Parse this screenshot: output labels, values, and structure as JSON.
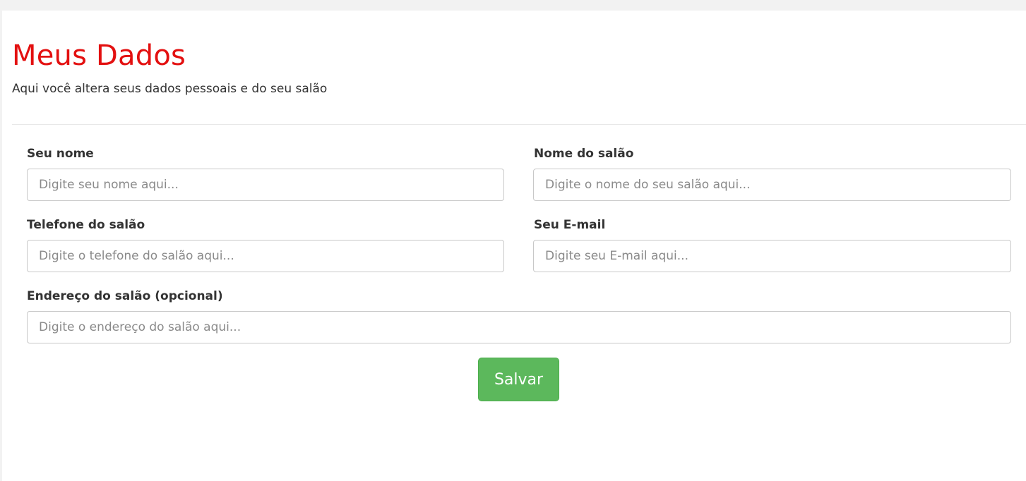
{
  "header": {
    "title": "Meus Dados",
    "subtitle": "Aqui você altera seus dados pessoais e do seu salão"
  },
  "form": {
    "name": {
      "label": "Seu nome",
      "placeholder": "Digite seu nome aqui...",
      "value": ""
    },
    "salon_name": {
      "label": "Nome do salão",
      "placeholder": "Digite o nome do seu salão aqui...",
      "value": ""
    },
    "salon_phone": {
      "label": "Telefone do salão",
      "placeholder": "Digite o telefone do salão aqui...",
      "value": ""
    },
    "email": {
      "label": "Seu E-mail",
      "placeholder": "Digite seu E-mail aqui...",
      "value": ""
    },
    "salon_address": {
      "label": "Endereço do salão (opcional)",
      "placeholder": "Digite o endereço do salão aqui...",
      "value": ""
    },
    "save_label": "Salvar"
  },
  "colors": {
    "title": "#e31010",
    "save_button": "#5cb85c",
    "background": "#f2f2f2"
  }
}
